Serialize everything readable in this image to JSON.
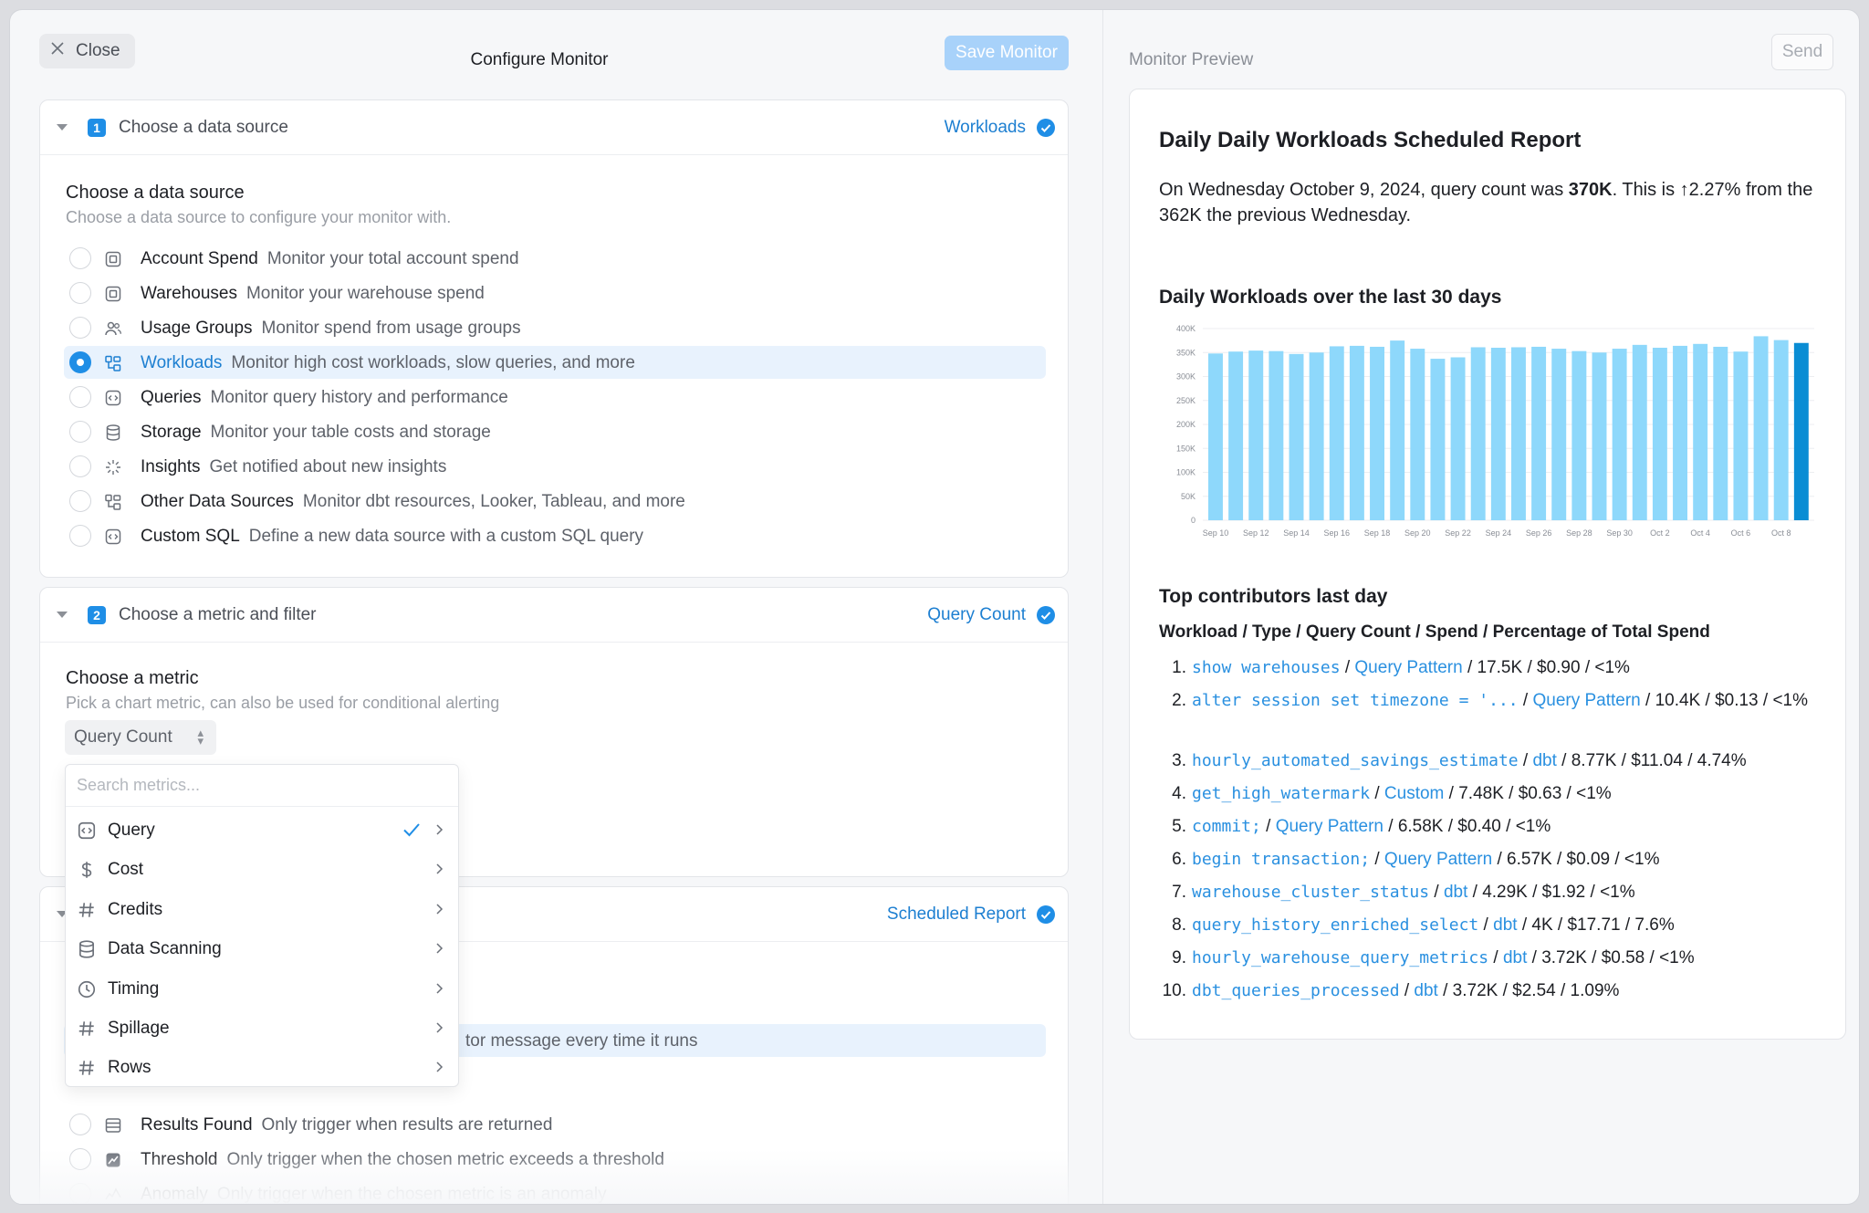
{
  "header": {
    "close_label": "Close",
    "title": "Configure Monitor",
    "save_label": "Save Monitor",
    "preview_title": "Monitor Preview",
    "send_label": "Send"
  },
  "step1": {
    "num": "1",
    "title": "Choose a data source",
    "value": "Workloads",
    "section_title": "Choose a data source",
    "section_sub": "Choose a data source to configure your monitor with.",
    "options": [
      {
        "name": "Account Spend",
        "desc": "Monitor your total account spend",
        "icon": "account-icon",
        "selected": false
      },
      {
        "name": "Warehouses",
        "desc": "Monitor your warehouse spend",
        "icon": "warehouse-icon",
        "selected": false
      },
      {
        "name": "Usage Groups",
        "desc": "Monitor spend from usage groups",
        "icon": "users-icon",
        "selected": false
      },
      {
        "name": "Workloads",
        "desc": "Monitor high cost workloads, slow queries, and more",
        "icon": "workloads-icon",
        "selected": true
      },
      {
        "name": "Queries",
        "desc": "Monitor query history and performance",
        "icon": "code-icon",
        "selected": false
      },
      {
        "name": "Storage",
        "desc": "Monitor your table costs and storage",
        "icon": "database-icon",
        "selected": false
      },
      {
        "name": "Insights",
        "desc": "Get notified about new insights",
        "icon": "sparkle-icon",
        "selected": false
      },
      {
        "name": "Other Data Sources",
        "desc": "Monitor dbt resources, Looker, Tableau, and more",
        "icon": "workloads-icon",
        "selected": false
      },
      {
        "name": "Custom SQL",
        "desc": "Define a new data source with a custom SQL query",
        "icon": "code-icon",
        "selected": false
      }
    ]
  },
  "step2": {
    "num": "2",
    "title": "Choose a metric and filter",
    "value": "Query Count",
    "section_title": "Choose a metric",
    "section_sub": "Pick a chart metric, can also be used for conditional alerting",
    "dropdown_value": "Query Count",
    "search_placeholder": "Search metrics...",
    "menu": [
      {
        "label": "Query",
        "icon": "code-icon",
        "checked": true
      },
      {
        "label": "Cost",
        "icon": "dollar-icon",
        "checked": false
      },
      {
        "label": "Credits",
        "icon": "hash-icon",
        "checked": false
      },
      {
        "label": "Data Scanning",
        "icon": "database-icon",
        "checked": false
      },
      {
        "label": "Timing",
        "icon": "clock-icon",
        "checked": false
      },
      {
        "label": "Spillage",
        "icon": "hash-icon",
        "checked": false
      },
      {
        "label": "Rows",
        "icon": "hash-icon",
        "checked": false
      }
    ]
  },
  "step3": {
    "value": "Scheduled Report",
    "partial_option_text": "tor message every time it runs",
    "options": [
      {
        "name": "Results Found",
        "desc": "Only trigger when results are returned",
        "icon": "table-icon"
      },
      {
        "name": "Threshold",
        "desc": "Only trigger when the chosen metric exceeds a threshold",
        "icon": "threshold-icon"
      },
      {
        "name": "Anomaly",
        "desc": "Only trigger when the chosen metric is an anomaly",
        "icon": "anomaly-icon"
      }
    ]
  },
  "preview": {
    "report_title": "Daily Daily Workloads Scheduled Report",
    "summary_pre": "On Wednesday October 9, 2024, query count was ",
    "summary_bold": "370K",
    "summary_post": ". This is ↑2.27% from the 362K the previous Wednesday.",
    "chart_title": "Daily Workloads over the last 30 days",
    "contrib_title": "Top contributors last day",
    "contrib_header": "Workload / Type / Query Count / Spend / Percentage of Total Spend",
    "contributors": [
      {
        "n": "1.",
        "workload": "show warehouses",
        "type": "Query Pattern",
        "rest": " / 17.5K / $0.90 / <1%"
      },
      {
        "n": "2.",
        "workload": "alter session set timezone = '...",
        "type": "Query Pattern",
        "rest": " / 10.4K / $0.13 / <1%"
      },
      {
        "n": "3.",
        "workload": "hourly_automated_savings_estimate",
        "type": "dbt",
        "rest": " / 8.77K / $11.04 / 4.74%"
      },
      {
        "n": "4.",
        "workload": "get_high_watermark",
        "type": "Custom",
        "rest": " / 7.48K / $0.63 / <1%"
      },
      {
        "n": "5.",
        "workload": "commit;",
        "type": "Query Pattern",
        "rest": " / 6.58K / $0.40 / <1%"
      },
      {
        "n": "6.",
        "workload": "begin transaction;",
        "type": "Query Pattern",
        "rest": " / 6.57K / $0.09 / <1%"
      },
      {
        "n": "7.",
        "workload": "warehouse_cluster_status",
        "type": "dbt",
        "rest": " / 4.29K / $1.92 / <1%"
      },
      {
        "n": "8.",
        "workload": "query_history_enriched_select",
        "type": "dbt",
        "rest": " / 4K / $17.71 / 7.6%"
      },
      {
        "n": "9.",
        "workload": "hourly_warehouse_query_metrics",
        "type": "dbt",
        "rest": " / 3.72K / $0.58 / <1%"
      },
      {
        "n": "10.",
        "workload": "dbt_queries_processed",
        "type": "dbt",
        "rest": " / 3.72K / $2.54 / 1.09%"
      }
    ]
  },
  "chart_data": {
    "type": "bar",
    "title": "Daily Workloads over the last 30 days",
    "y_ticks": [
      "0",
      "50K",
      "100K",
      "150K",
      "200K",
      "250K",
      "300K",
      "350K",
      "400K"
    ],
    "ylim": [
      0,
      400000
    ],
    "x_tick_labels": [
      "Sep 10",
      "Sep 12",
      "Sep 14",
      "Sep 16",
      "Sep 18",
      "Sep 20",
      "Sep 22",
      "Sep 24",
      "Sep 26",
      "Sep 28",
      "Sep 30",
      "Oct 2",
      "Oct 4",
      "Oct 6",
      "Oct 8"
    ],
    "categories": [
      "Sep 10",
      "Sep 11",
      "Sep 12",
      "Sep 13",
      "Sep 14",
      "Sep 15",
      "Sep 16",
      "Sep 17",
      "Sep 18",
      "Sep 19",
      "Sep 20",
      "Sep 21",
      "Sep 22",
      "Sep 23",
      "Sep 24",
      "Sep 25",
      "Sep 26",
      "Sep 27",
      "Sep 28",
      "Sep 29",
      "Sep 30",
      "Oct 1",
      "Oct 2",
      "Oct 3",
      "Oct 4",
      "Oct 5",
      "Oct 6",
      "Oct 7",
      "Oct 8",
      "Oct 9"
    ],
    "values": [
      348000,
      352000,
      354000,
      353000,
      347000,
      350000,
      363000,
      364000,
      362000,
      375000,
      358000,
      337000,
      340000,
      361000,
      360000,
      361000,
      362000,
      358000,
      353000,
      350000,
      358000,
      366000,
      360000,
      364000,
      368000,
      362000,
      352000,
      384000,
      376000,
      370000
    ],
    "highlight_index": 29,
    "colors": {
      "bar": "#8ed8fb",
      "highlight": "#0a8dd4"
    },
    "grid": true
  }
}
